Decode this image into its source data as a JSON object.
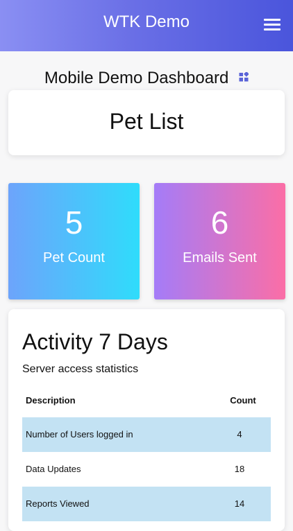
{
  "header": {
    "title": "WTK Demo",
    "menu_icon": "hamburger-menu-icon",
    "gradient": [
      "#8a8ff3",
      "#4a55dc"
    ]
  },
  "dashboard": {
    "title": "Mobile Demo Dashboard",
    "icon": "dashboard-widgets-icon",
    "icon_color": "#5a63d8"
  },
  "pet_list": {
    "label": "Pet List"
  },
  "stats": [
    {
      "value": "5",
      "label": "Pet Count",
      "colors": [
        "#6da4fb",
        "#2fdcfb"
      ]
    },
    {
      "value": "6",
      "label": "Emails Sent",
      "colors": [
        "#a47cf8",
        "#fb6ea6"
      ]
    }
  ],
  "activity": {
    "title": "Activity 7 Days",
    "subtitle": "Server access statistics",
    "columns": [
      "Description",
      "Count"
    ],
    "rows": [
      {
        "description": "Number of Users logged in",
        "count": "4"
      },
      {
        "description": "Data Updates",
        "count": "18"
      },
      {
        "description": "Reports Viewed",
        "count": "14"
      }
    ],
    "row_highlight_color": "#c3e2f3"
  }
}
